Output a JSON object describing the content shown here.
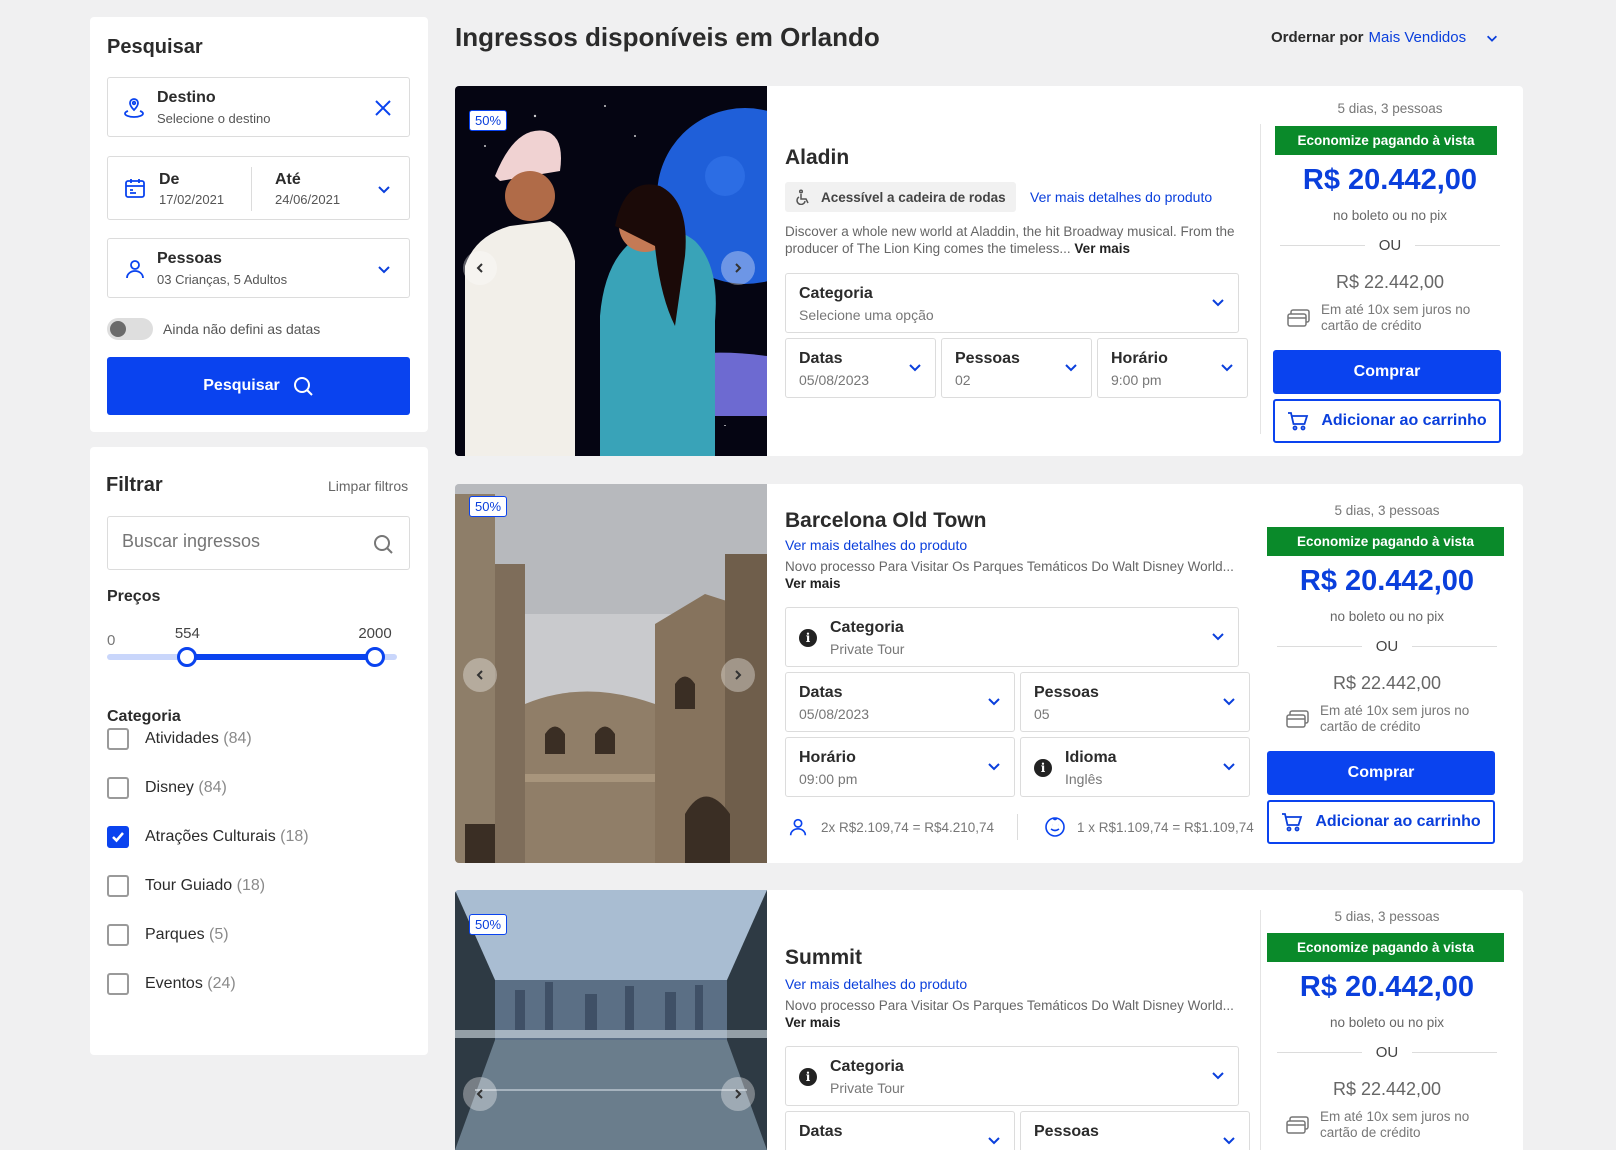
{
  "search": {
    "title": "Pesquisar",
    "destination_label": "Destino",
    "destination_placeholder": "Selecione o destino",
    "from_label": "De",
    "from_value": "17/02/2021",
    "to_label": "Até",
    "to_value": "24/06/2021",
    "people_label": "Pessoas",
    "people_value": "03 Crianças, 5 Adultos",
    "toggle_label": "Ainda não defini as datas",
    "button_label": "Pesquisar"
  },
  "filter": {
    "title": "Filtrar",
    "clear_label": "Limpar filtros",
    "search_placeholder": "Buscar ingressos",
    "prices_label": "Preços",
    "price_min": "0",
    "price_low": "554",
    "price_high": "2000",
    "price_range": {
      "min": 0,
      "max": 2000,
      "low": 554,
      "high": 2000
    },
    "category_title": "Categoria",
    "categories": [
      {
        "label": "Atividades",
        "count": "(84)",
        "checked": false
      },
      {
        "label": "Disney",
        "count": "(84)",
        "checked": false
      },
      {
        "label": "Atrações Culturais",
        "count": "(18)",
        "checked": true
      },
      {
        "label": "Tour Guiado",
        "count": "(18)",
        "checked": false
      },
      {
        "label": "Parques",
        "count": "(5)",
        "checked": false
      },
      {
        "label": "Eventos",
        "count": "(24)",
        "checked": false
      }
    ]
  },
  "header": {
    "title": "Ingressos disponíveis em Orlando",
    "sort_prefix": "Ordernar por",
    "sort_value": "Mais Vendidos"
  },
  "products": [
    {
      "badge": "50%",
      "title": "Aladin",
      "accessibility": "Acessível a cadeira de rodas",
      "details_link": "Ver mais detalhes do produto",
      "description": "Discover a whole new world at Aladdin, the hit Broadway musical. From the producer of The Lion King comes the timeless...",
      "more": "Ver mais",
      "category": {
        "label": "Categoria",
        "value": "Selecione uma opção"
      },
      "dates": {
        "label": "Datas",
        "value": "05/08/2023"
      },
      "people": {
        "label": "Pessoas",
        "value": "02"
      },
      "time": {
        "label": "Horário",
        "value": "9:00 pm"
      },
      "price": {
        "meta": "5 dias, 3 pessoas",
        "promo": "Economize pagando à vista",
        "value": "R$ 20.442,00",
        "method": "no boleto ou no pix",
        "or": "OU",
        "old": "R$ 22.442,00",
        "installments": "Em até 10x sem juros no cartão de crédito"
      },
      "buy": "Comprar",
      "cart": "Adicionar ao carrinho"
    },
    {
      "badge": "50%",
      "title": "Barcelona Old Town",
      "details_link": "Ver mais detalhes do produto",
      "description": "Novo processo Para Visitar Os Parques Temáticos Do Walt Disney World...",
      "more": "Ver mais",
      "category": {
        "label": "Categoria",
        "value": "Private Tour"
      },
      "dates": {
        "label": "Datas",
        "value": "05/08/2023"
      },
      "people": {
        "label": "Pessoas",
        "value": "05"
      },
      "time": {
        "label": "Horário",
        "value": "09:00 pm"
      },
      "language": {
        "label": "Idioma",
        "value": "Inglês"
      },
      "adult_price": "2x R$2.109,74 = R$4.210,74",
      "child_price": "1 x R$1.109,74 = R$1.109,74",
      "price": {
        "meta": "5 dias, 3 pessoas",
        "promo": "Economize pagando à vista",
        "value": "R$ 20.442,00",
        "method": "no boleto ou no pix",
        "or": "OU",
        "old": "R$ 22.442,00",
        "installments": "Em até 10x sem juros no cartão de crédito"
      },
      "buy": "Comprar",
      "cart": "Adicionar ao carrinho"
    },
    {
      "badge": "50%",
      "title": "Summit",
      "details_link": "Ver mais detalhes do produto",
      "description": "Novo processo Para Visitar Os Parques Temáticos Do Walt Disney World...",
      "more": "Ver mais",
      "category": {
        "label": "Categoria",
        "value": "Private Tour"
      },
      "dates": {
        "label": "Datas",
        "value": ""
      },
      "people": {
        "label": "Pessoas",
        "value": ""
      },
      "price": {
        "meta": "5 dias, 3 pessoas",
        "promo": "Economize pagando à vista",
        "value": "R$ 20.442,00",
        "method": "no boleto ou no pix",
        "or": "OU",
        "old": "R$ 22.442,00",
        "installments": "Em até 10x sem juros no cartão de crédito"
      }
    }
  ]
}
